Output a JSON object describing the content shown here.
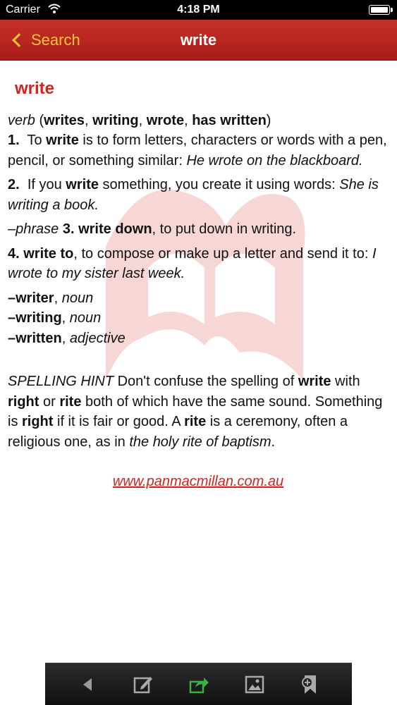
{
  "status_bar": {
    "carrier": "Carrier",
    "time": "4:18 PM"
  },
  "nav": {
    "back_label": "Search",
    "title": "write"
  },
  "entry": {
    "headword": "write",
    "pos_line": {
      "pos": "verb",
      "open": " (",
      "forms": [
        "writes",
        "writing",
        "wrote",
        "has written"
      ],
      "sep": ", ",
      "close": ")"
    },
    "senses": [
      {
        "num": "1.",
        "pre": "To ",
        "kw": "write",
        "text": " is to form letters, characters or words with a pen, pencil, or something similar: ",
        "example": "He wrote on the blackboard."
      },
      {
        "num": "2.",
        "pre": "If you ",
        "kw": "write",
        "text": " something, you create it using words: ",
        "example": "She is writing a book."
      }
    ],
    "phrase_line": {
      "label": "–phrase",
      "num": "3.",
      "kw": "write down",
      "text": ", to put down in writing."
    },
    "sense4": {
      "num": "4.",
      "kw": "write to",
      "text": ", to compose or make up a letter and send it to: ",
      "example": "I wrote to my sister last week."
    },
    "derivatives": [
      {
        "word": "–writer",
        "pos": "noun"
      },
      {
        "word": "–writing",
        "pos": "noun"
      },
      {
        "word": "–written",
        "pos": "adjective"
      }
    ],
    "hint": {
      "label": "SPELLING HINT",
      "t1": " Don't confuse the spelling of ",
      "w1": "write",
      "t2": " with ",
      "w2": "right",
      "t3": " or ",
      "w3": "rite",
      "t4": " both of which have the same sound. Something is ",
      "w4": "right",
      "t5": " if it is fair or good. A ",
      "w5": "rite",
      "t6": " is a ceremony, often a religious one, as in ",
      "e1": "the holy rite of baptism",
      "t7": "."
    },
    "link": "www.panmacmillan.com.au"
  },
  "toolbar": {
    "icons": [
      "back-arrow-icon",
      "edit-note-icon",
      "share-icon",
      "image-icon",
      "bookmark-add-icon"
    ]
  },
  "colors": {
    "nav_bg": "#b8231c",
    "accent": "#f5c53a",
    "headword": "#d1261f",
    "share_icon": "#3cb043"
  }
}
